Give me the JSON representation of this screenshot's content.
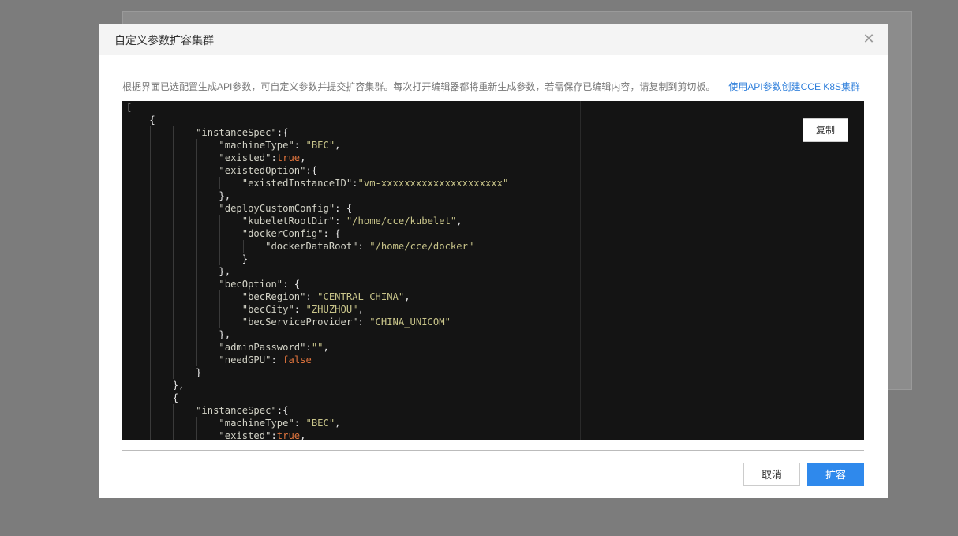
{
  "modal": {
    "title": "自定义参数扩容集群",
    "close_icon": "close-icon",
    "description": "根据界面已选配置生成API参数，可自定义参数并提交扩容集群。每次打开编辑器都将重新生成参数，若需保存已编辑内容，请复制到剪切板。",
    "api_link": "使用API参数创建CCE K8S集群",
    "copy_label": "复制",
    "cancel_label": "取消",
    "confirm_label": "扩容"
  },
  "colors": {
    "editor_bg": "#141414",
    "key": "#d2d2c6",
    "string": "#c9c58a",
    "boolean": "#e0743d",
    "primary": "#2f89ec",
    "link": "#2f7fdb"
  },
  "code_lines": [
    {
      "indent": 0,
      "parts": [
        {
          "t": "p",
          "v": "["
        }
      ]
    },
    {
      "indent": 1,
      "parts": [
        {
          "t": "p",
          "v": "{"
        }
      ]
    },
    {
      "indent": 3,
      "parts": [
        {
          "t": "k",
          "v": "\"instanceSpec\""
        },
        {
          "t": "p",
          "v": ":{"
        }
      ]
    },
    {
      "indent": 4,
      "parts": [
        {
          "t": "k",
          "v": "\"machineType\""
        },
        {
          "t": "p",
          "v": ": "
        },
        {
          "t": "s",
          "v": "\"BEC\""
        },
        {
          "t": "p",
          "v": ","
        }
      ]
    },
    {
      "indent": 4,
      "parts": [
        {
          "t": "k",
          "v": "\"existed\""
        },
        {
          "t": "p",
          "v": ":"
        },
        {
          "t": "b",
          "v": "true"
        },
        {
          "t": "p",
          "v": ","
        }
      ]
    },
    {
      "indent": 4,
      "parts": [
        {
          "t": "k",
          "v": "\"existedOption\""
        },
        {
          "t": "p",
          "v": ":{"
        }
      ]
    },
    {
      "indent": 5,
      "parts": [
        {
          "t": "k",
          "v": "\"existedInstanceID\""
        },
        {
          "t": "p",
          "v": ":"
        },
        {
          "t": "s",
          "v": "\"vm-xxxxxxxxxxxxxxxxxxxxx\""
        }
      ]
    },
    {
      "indent": 4,
      "parts": [
        {
          "t": "p",
          "v": "},"
        }
      ]
    },
    {
      "indent": 4,
      "parts": [
        {
          "t": "k",
          "v": "\"deployCustomConfig\""
        },
        {
          "t": "p",
          "v": ": {"
        }
      ]
    },
    {
      "indent": 5,
      "parts": [
        {
          "t": "k",
          "v": "\"kubeletRootDir\""
        },
        {
          "t": "p",
          "v": ": "
        },
        {
          "t": "s",
          "v": "\"/home/cce/kubelet\""
        },
        {
          "t": "p",
          "v": ","
        }
      ]
    },
    {
      "indent": 5,
      "parts": [
        {
          "t": "k",
          "v": "\"dockerConfig\""
        },
        {
          "t": "p",
          "v": ": {"
        }
      ]
    },
    {
      "indent": 6,
      "parts": [
        {
          "t": "k",
          "v": "\"dockerDataRoot\""
        },
        {
          "t": "p",
          "v": ": "
        },
        {
          "t": "s",
          "v": "\"/home/cce/docker\""
        }
      ]
    },
    {
      "indent": 5,
      "parts": [
        {
          "t": "p",
          "v": "}"
        }
      ]
    },
    {
      "indent": 4,
      "parts": [
        {
          "t": "p",
          "v": "},"
        }
      ]
    },
    {
      "indent": 4,
      "parts": [
        {
          "t": "k",
          "v": "\"becOption\""
        },
        {
          "t": "p",
          "v": ": {"
        }
      ]
    },
    {
      "indent": 5,
      "parts": [
        {
          "t": "k",
          "v": "\"becRegion\""
        },
        {
          "t": "p",
          "v": ": "
        },
        {
          "t": "s",
          "v": "\"CENTRAL_CHINA\""
        },
        {
          "t": "p",
          "v": ","
        }
      ]
    },
    {
      "indent": 5,
      "parts": [
        {
          "t": "k",
          "v": "\"becCity\""
        },
        {
          "t": "p",
          "v": ": "
        },
        {
          "t": "s",
          "v": "\"ZHUZHOU\""
        },
        {
          "t": "p",
          "v": ","
        }
      ]
    },
    {
      "indent": 5,
      "parts": [
        {
          "t": "k",
          "v": "\"becServiceProvider\""
        },
        {
          "t": "p",
          "v": ": "
        },
        {
          "t": "s",
          "v": "\"CHINA_UNICOM\""
        }
      ]
    },
    {
      "indent": 4,
      "parts": [
        {
          "t": "p",
          "v": "},"
        }
      ]
    },
    {
      "indent": 4,
      "parts": [
        {
          "t": "k",
          "v": "\"adminPassword\""
        },
        {
          "t": "p",
          "v": ":"
        },
        {
          "t": "s",
          "v": "\"\""
        },
        {
          "t": "p",
          "v": ","
        }
      ]
    },
    {
      "indent": 4,
      "parts": [
        {
          "t": "k",
          "v": "\"needGPU\""
        },
        {
          "t": "p",
          "v": ": "
        },
        {
          "t": "b",
          "v": "false"
        }
      ]
    },
    {
      "indent": 3,
      "parts": [
        {
          "t": "p",
          "v": "}"
        }
      ]
    },
    {
      "indent": 2,
      "parts": [
        {
          "t": "p",
          "v": "},"
        }
      ]
    },
    {
      "indent": 2,
      "parts": [
        {
          "t": "p",
          "v": "{"
        }
      ]
    },
    {
      "indent": 3,
      "parts": [
        {
          "t": "k",
          "v": "\"instanceSpec\""
        },
        {
          "t": "p",
          "v": ":{"
        }
      ]
    },
    {
      "indent": 4,
      "parts": [
        {
          "t": "k",
          "v": "\"machineType\""
        },
        {
          "t": "p",
          "v": ": "
        },
        {
          "t": "s",
          "v": "\"BEC\""
        },
        {
          "t": "p",
          "v": ","
        }
      ]
    },
    {
      "indent": 4,
      "parts": [
        {
          "t": "k",
          "v": "\"existed\""
        },
        {
          "t": "p",
          "v": ":"
        },
        {
          "t": "b",
          "v": "true"
        },
        {
          "t": "p",
          "v": ","
        }
      ]
    }
  ]
}
